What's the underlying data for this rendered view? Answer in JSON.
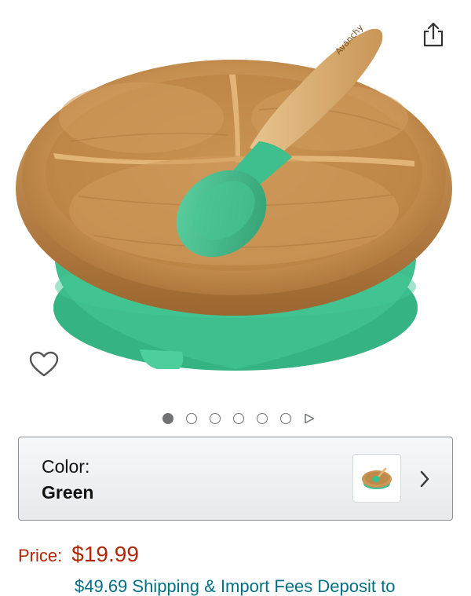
{
  "product": {
    "image_alt": "Bamboo suction plate with green spoon",
    "image_count": 6,
    "active_image_index": 0,
    "brand_engraving": "Avanchy"
  },
  "actions": {
    "share_icon": "share-icon",
    "wishlist_icon": "heart-outline-icon",
    "next_icon": "play-triangle-icon"
  },
  "variation": {
    "label": "Color:",
    "value": "Green",
    "chevron_icon": "chevron-right-icon"
  },
  "pricing": {
    "label": "Price:",
    "value": "$19.99",
    "shipping_text": "$49.69 Shipping & Import Fees Deposit to"
  },
  "colors": {
    "price": "#b12704",
    "link": "#007185",
    "silicone_green": "#3fb98a",
    "bamboo": "#c99657"
  }
}
